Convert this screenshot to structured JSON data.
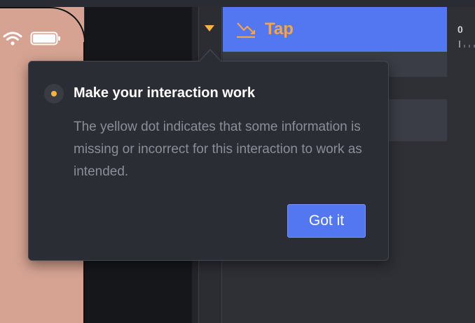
{
  "layer": {
    "tap_label": "Tap",
    "ruler_value": "0",
    "warning_color": "#f5b342",
    "accent_color": "#5277f0"
  },
  "status_bar": {
    "icons": [
      "wifi-icon",
      "battery-icon"
    ]
  },
  "popover": {
    "title": "Make your interaction work",
    "body": "The yellow dot indicates that some information is missing or incorrect for this interaction to work as intended.",
    "button_label": "Got it",
    "indicator": "yellow-dot-icon"
  }
}
